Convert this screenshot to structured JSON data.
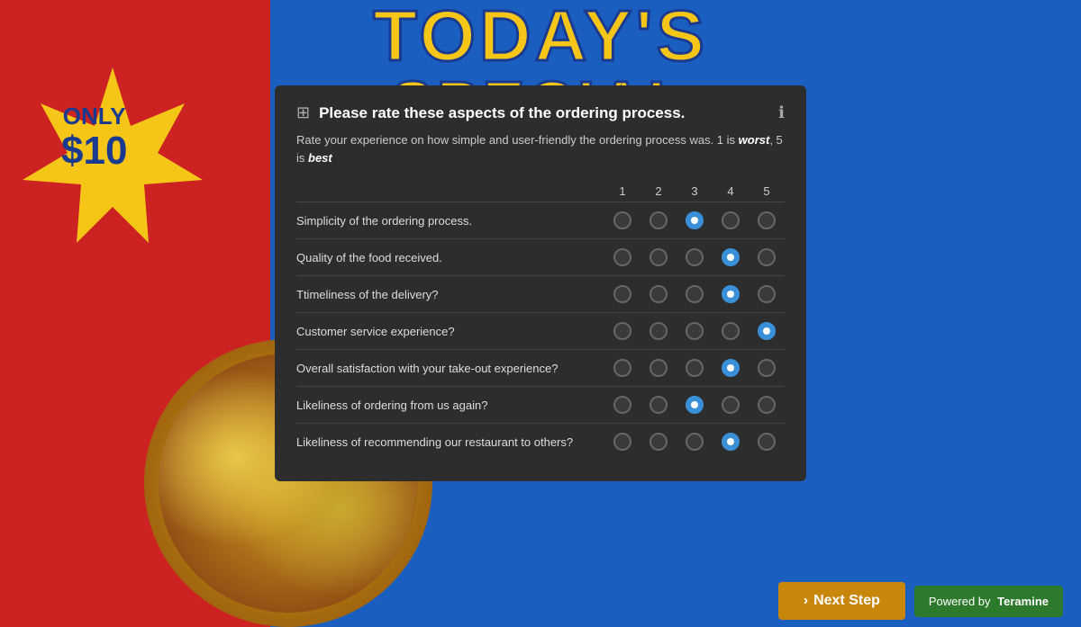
{
  "background": {
    "left_color": "#cc2222",
    "right_color": "#1a5fbf"
  },
  "banner": {
    "line1": "TODAY'S",
    "line2": "SPECIAL"
  },
  "badge": {
    "line1": "ONLY",
    "line2": "$10"
  },
  "modal": {
    "icon": "⊞",
    "title": "Please rate these aspects of the ordering process.",
    "info_icon": "ℹ",
    "description_start": "Rate your experience on how simple and user-friendly the ordering process was. 1 is ",
    "worst_label": "worst",
    "description_middle": ", 5 is ",
    "best_label": "best",
    "columns": [
      "1",
      "2",
      "3",
      "4",
      "5"
    ],
    "rows": [
      {
        "label": "Simplicity of the ordering process.",
        "selected": 3
      },
      {
        "label": "Quality of the food received.",
        "selected": 4
      },
      {
        "label": "Ttimeliness of the delivery?",
        "selected": 4
      },
      {
        "label": "Customer service experience?",
        "selected": 5
      },
      {
        "label": "Overall satisfaction with your take-out experience?",
        "selected": 4
      },
      {
        "label": "Likeliness of ordering from us again?",
        "selected": 3
      },
      {
        "label": "Likeliness of recommending our restaurant to others?",
        "selected": 4
      }
    ]
  },
  "next_step_button": {
    "label": "Next Step",
    "arrow": "›"
  },
  "powered_by": {
    "prefix": "Powered by",
    "brand": "Teramine"
  }
}
